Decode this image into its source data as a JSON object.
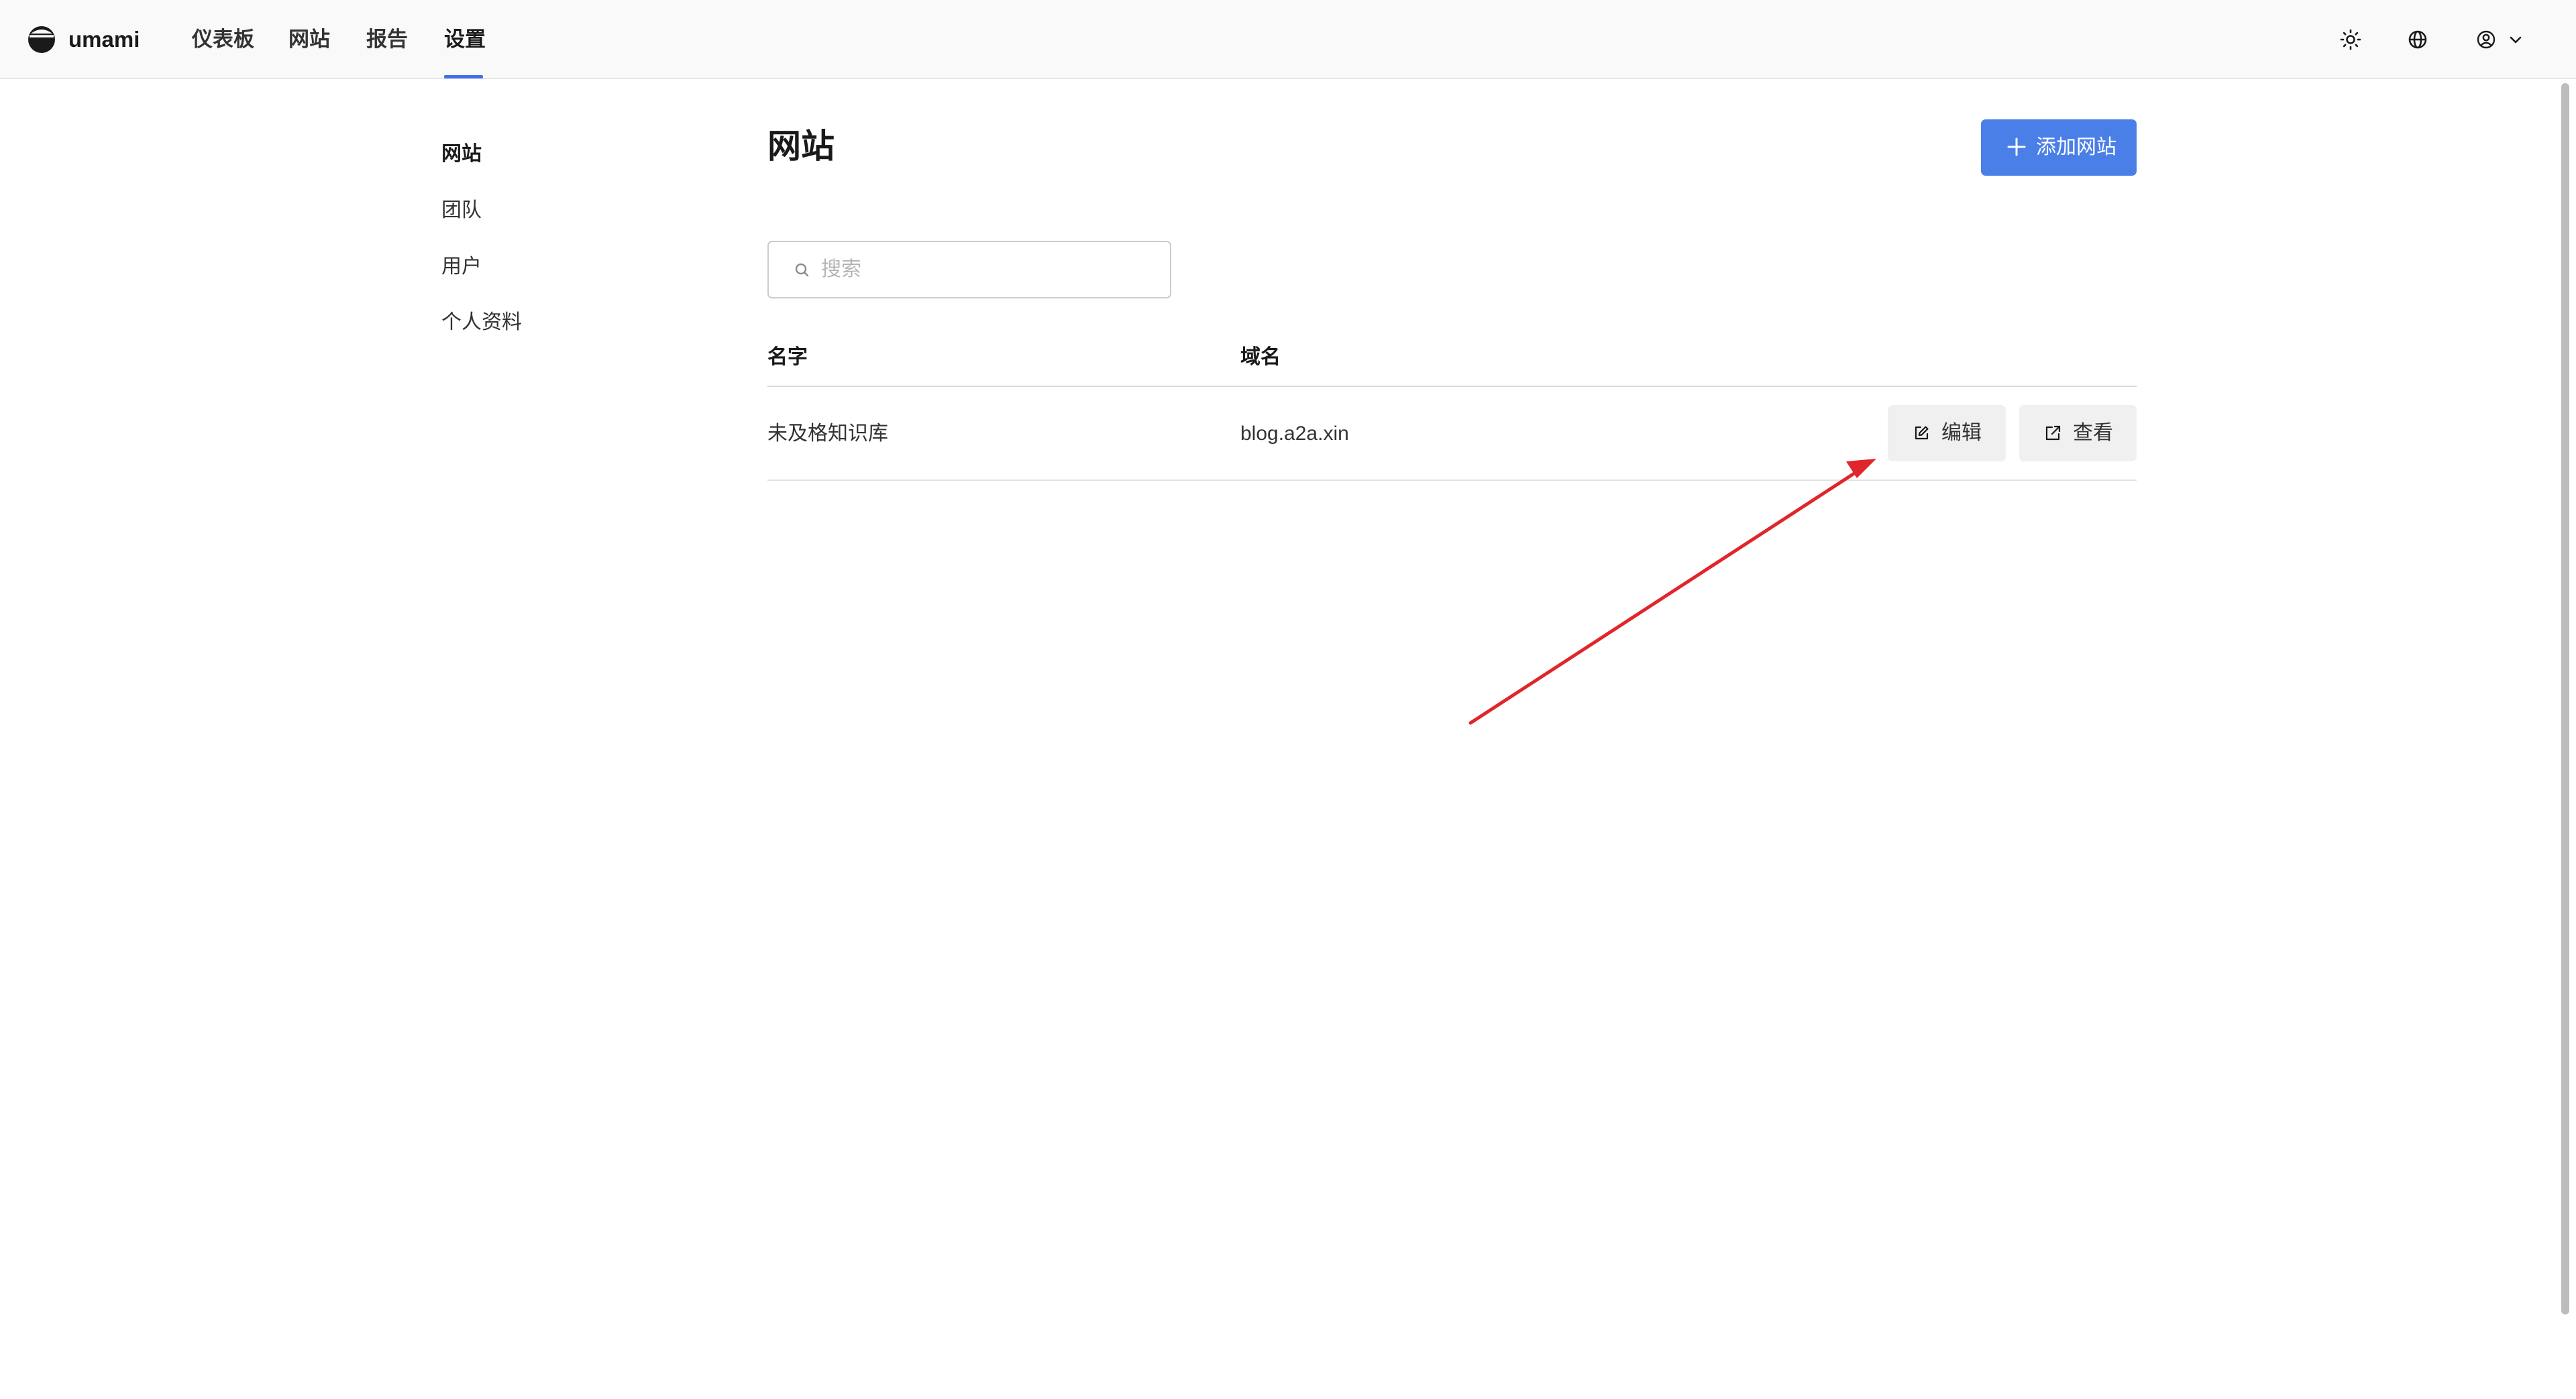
{
  "brand": {
    "name": "umami"
  },
  "nav": {
    "items": [
      {
        "label": "仪表板"
      },
      {
        "label": "网站"
      },
      {
        "label": "报告"
      },
      {
        "label": "设置"
      }
    ],
    "active": "设置"
  },
  "topbar_icons": [
    "sun-icon",
    "globe-icon",
    "user-circle-icon",
    "chevron-down-icon"
  ],
  "sidebar": {
    "items": [
      {
        "label": "网站"
      },
      {
        "label": "团队"
      },
      {
        "label": "用户"
      },
      {
        "label": "个人资料"
      }
    ],
    "active": "网站"
  },
  "main": {
    "title": "网站",
    "add_button_label": "添加网站",
    "search": {
      "placeholder": "搜索",
      "value": ""
    },
    "table": {
      "columns": [
        "名字",
        "域名"
      ],
      "rows": [
        {
          "name": "未及格知识库",
          "domain": "blog.a2a.xin",
          "edit_label": "编辑",
          "view_label": "查看"
        }
      ]
    }
  },
  "colors": {
    "accent": "#4a7fe8",
    "nav_underline": "#3f70e6",
    "annotation_arrow": "#e0262b"
  }
}
